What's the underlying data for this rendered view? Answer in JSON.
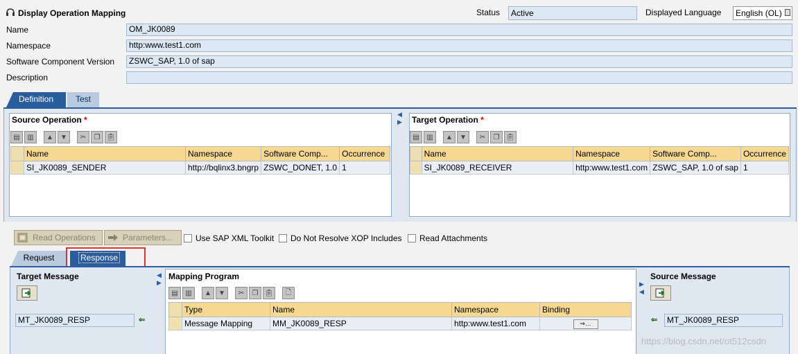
{
  "header": {
    "title": "Display Operation Mapping",
    "status_label": "Status",
    "status_value": "Active",
    "language_label": "Displayed Language",
    "language_value": "English (OL)"
  },
  "fields": {
    "name_label": "Name",
    "name_value": "OM_JK0089",
    "namespace_label": "Namespace",
    "namespace_value": "http:www.test1.com",
    "swcv_label": "Software Component Version",
    "swcv_value": "ZSWC_SAP, 1.0 of sap",
    "description_label": "Description",
    "description_value": ""
  },
  "main_tabs": [
    {
      "label": "Definition",
      "active": true
    },
    {
      "label": "Test",
      "active": false
    }
  ],
  "source_operation": {
    "title": "Source Operation",
    "required": "*",
    "columns": [
      "Name",
      "Namespace",
      "Software Comp...",
      "Occurrence"
    ],
    "rows": [
      [
        "SI_JK0089_SENDER",
        "http://bqlinx3.bngrp",
        "ZSWC_DONET, 1.0",
        "1"
      ]
    ]
  },
  "target_operation": {
    "title": "Target Operation",
    "required": "*",
    "columns": [
      "Name",
      "Namespace",
      "Software Comp...",
      "Occurrence"
    ],
    "rows": [
      [
        "SI_JK0089_RECEIVER",
        "http:www.test1.com",
        "ZSWC_SAP, 1.0 of sap",
        "1"
      ]
    ]
  },
  "actions": {
    "read_operations": "Read Operations",
    "parameters": "Parameters...",
    "use_sap_xml_toolkit": "Use SAP XML Toolkit",
    "do_not_resolve_xop": "Do Not Resolve XOP Includes",
    "read_attachments": "Read Attachments"
  },
  "sub_tabs": [
    {
      "label": "Request",
      "active": false
    },
    {
      "label": "Response",
      "active": true
    }
  ],
  "target_message": {
    "title": "Target Message",
    "value": "MT_JK0089_RESP"
  },
  "mapping_program": {
    "title": "Mapping Program",
    "columns": [
      "Type",
      "Name",
      "Namespace",
      "Binding"
    ],
    "rows": [
      [
        "Message Mapping",
        "MM_JK0089_RESP",
        "http:www.test1.com",
        ""
      ]
    ]
  },
  "source_message": {
    "title": "Source Message",
    "value": "MT_JK0089_RESP"
  },
  "watermark": "https://blog.csdn.net/ot512csdn",
  "colors": {
    "accent": "#2a5da0",
    "header_row": "#f7d891",
    "highlight": "#e03030"
  }
}
